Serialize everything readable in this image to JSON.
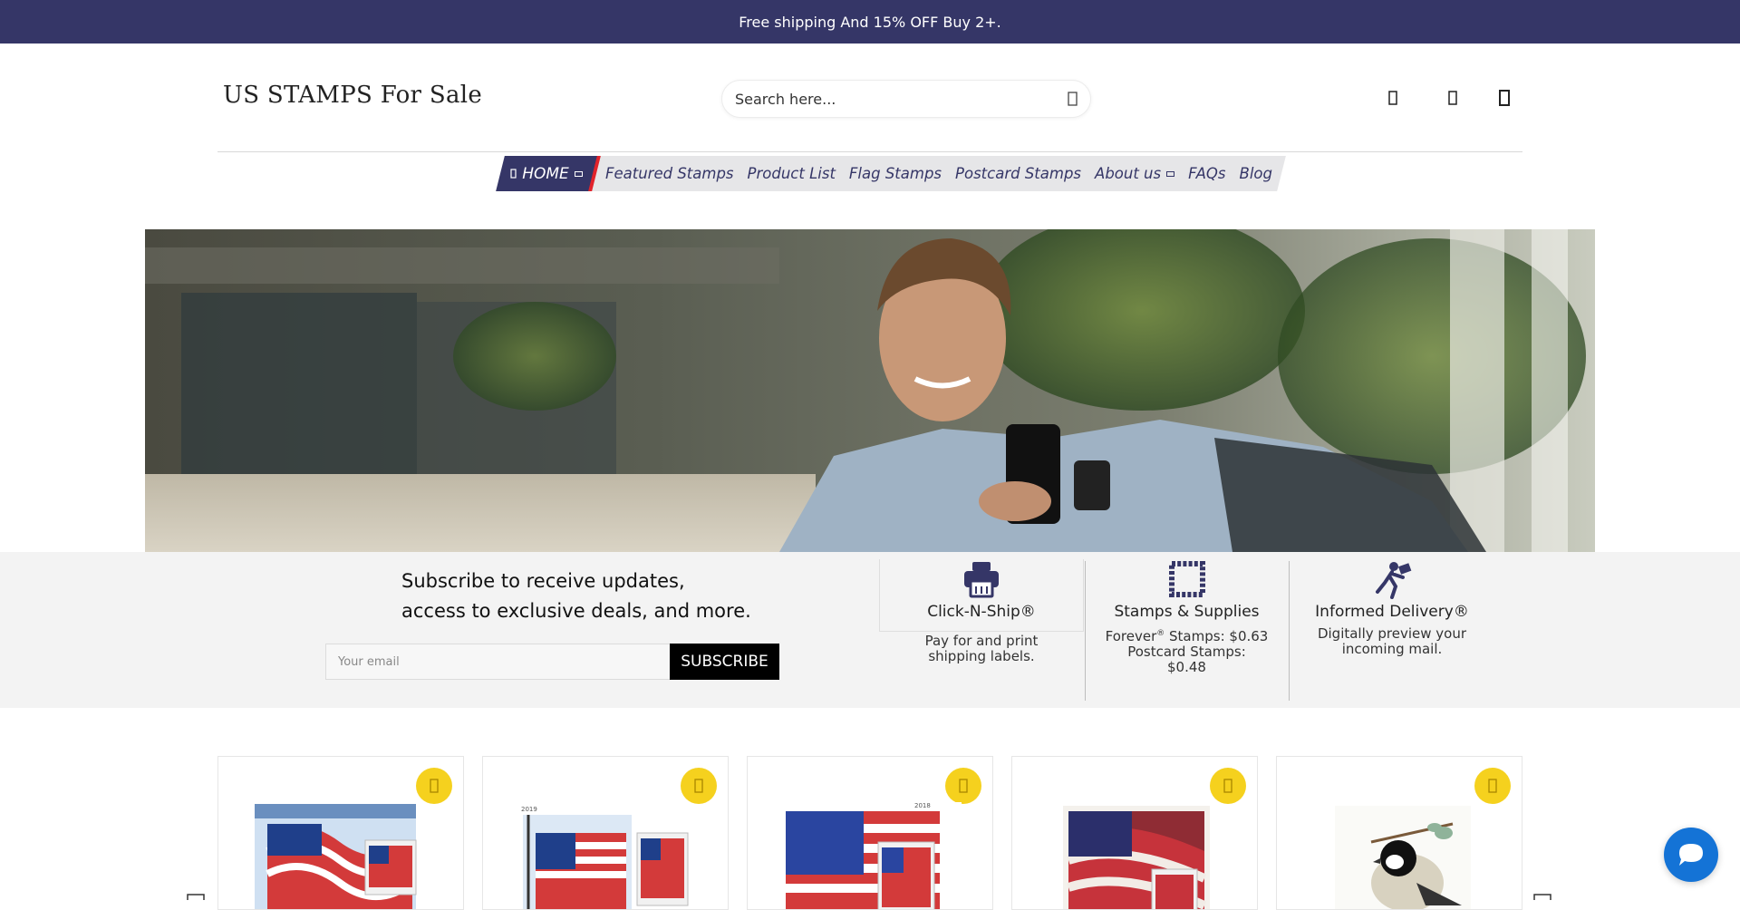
{
  "announcement": {
    "text": "Free shipping And 15% OFF Buy 2+."
  },
  "header": {
    "logo": "US STAMPS For Sale",
    "search_placeholder": "Search here...",
    "icons": [
      "account-icon",
      "wishlist-icon",
      "cart-icon"
    ]
  },
  "nav": {
    "items": [
      {
        "label": "HOME",
        "icon": "home-icon",
        "has_dropdown": true,
        "active": true
      },
      {
        "label": "Featured Stamps"
      },
      {
        "label": "Product List"
      },
      {
        "label": "Flag Stamps"
      },
      {
        "label": "Postcard Stamps"
      },
      {
        "label": "About us",
        "has_dropdown": true
      },
      {
        "label": "FAQs"
      },
      {
        "label": "Blog"
      }
    ]
  },
  "subscribe": {
    "line1": "Subscribe to receive updates,",
    "line2": "access to exclusive deals, and more.",
    "email_placeholder": "Your email",
    "button": "SUBSCRIBE"
  },
  "features": [
    {
      "icon": "printer-icon",
      "title": "Click-N-Ship®",
      "desc1": "Pay for and print",
      "desc2": "shipping labels."
    },
    {
      "icon": "stamp-icon",
      "title": "Stamps & Supplies",
      "desc1a": "Forever",
      "desc1sup": "®",
      "desc1b": " Stamps: $0.63",
      "desc2": "Postcard Stamps:",
      "desc3": "$0.48"
    },
    {
      "icon": "mail-carrier-icon",
      "title": "Informed Delivery®",
      "desc1": "Digitally preview your",
      "desc2": "incoming mail."
    }
  ],
  "products": [
    {
      "name": "flag-stamp-forever",
      "year": ""
    },
    {
      "name": "flag-stamp-2019",
      "year": "2019"
    },
    {
      "name": "flag-stamp-2018",
      "year": "2018"
    },
    {
      "name": "flag-stamp-waving",
      "year": ""
    },
    {
      "name": "chickadee-stamp",
      "year": ""
    }
  ],
  "colors": {
    "navy": "#353667",
    "accent_red": "#e2232b",
    "badge_yellow": "#f5d11e",
    "chat_blue": "#1473d6"
  }
}
